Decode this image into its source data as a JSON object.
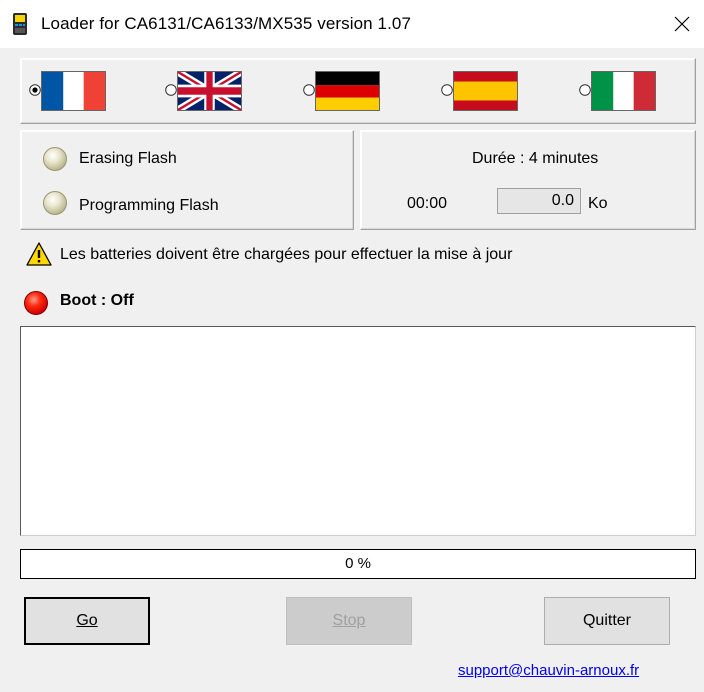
{
  "window": {
    "title": "Loader for CA6131/CA6133/MX535 version 1.07",
    "close_glyph": "✕"
  },
  "languages": [
    {
      "code": "fr",
      "icon": "france-flag-icon",
      "selected": true
    },
    {
      "code": "en",
      "icon": "uk-flag-icon",
      "selected": false
    },
    {
      "code": "de",
      "icon": "germany-flag-icon",
      "selected": false
    },
    {
      "code": "es",
      "icon": "spain-flag-icon",
      "selected": false
    },
    {
      "code": "it",
      "icon": "italy-flag-icon",
      "selected": false
    }
  ],
  "status": {
    "erasing_label": "Erasing Flash",
    "programming_label": "Programming Flash"
  },
  "duration": {
    "label": "Durée : 4 minutes",
    "time": "00:00",
    "size_value": "0.0",
    "size_unit": "Ko"
  },
  "warning": {
    "text": "Les batteries doivent être chargées pour effectuer la mise à jour",
    "icon": "warning-icon"
  },
  "boot": {
    "label": "Boot",
    "separator": ":",
    "value": "Off",
    "indicator_color": "#e00000"
  },
  "progress": {
    "percent": 0,
    "text": "0 %"
  },
  "buttons": {
    "go_label": "Go",
    "stop_label": "Stop",
    "quit_label": "Quitter"
  },
  "footer": {
    "support_link": "support@chauvin-arnoux.fr"
  }
}
